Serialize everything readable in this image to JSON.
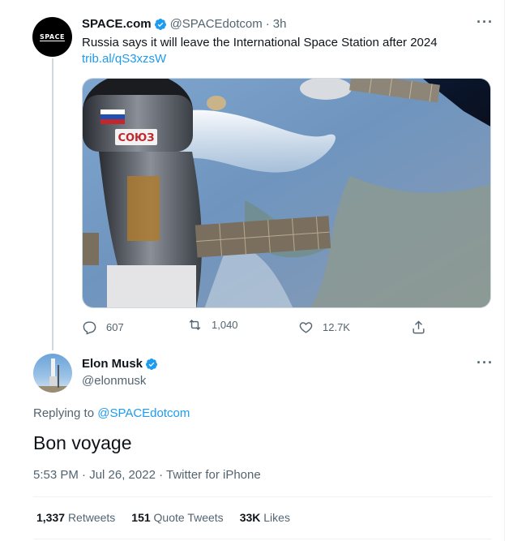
{
  "tweet1": {
    "author_name": "SPACE.com",
    "handle": "@SPACEdotcom",
    "separator": "·",
    "time": "3h",
    "avatar_label": "SPACE",
    "text": "Russia says it will leave the International Space Station after 2024",
    "link": "trib.al/qS3xzsW",
    "image_icon": "iss-earth-photo",
    "module_label": "COЮЗ",
    "actions": {
      "replies": "607",
      "retweets": "1,040",
      "likes": "12.7K"
    }
  },
  "tweet2": {
    "author_name": "Elon Musk",
    "handle": "@elonmusk",
    "replying_prefix": "Replying to",
    "replying_to": "@SPACEdotcom",
    "text": "Bon voyage",
    "timestamp": "5:53 PM · Jul 26, 2022 · Twitter for iPhone",
    "stats": {
      "retweets_count": "1,337",
      "retweets_label": "Retweets",
      "quotes_count": "151",
      "quotes_label": "Quote Tweets",
      "likes_count": "33K",
      "likes_label": "Likes"
    }
  },
  "colors": {
    "accent": "#1d9bf0",
    "text": "#0f1419",
    "muted": "#536471",
    "border": "#eff3f4"
  }
}
